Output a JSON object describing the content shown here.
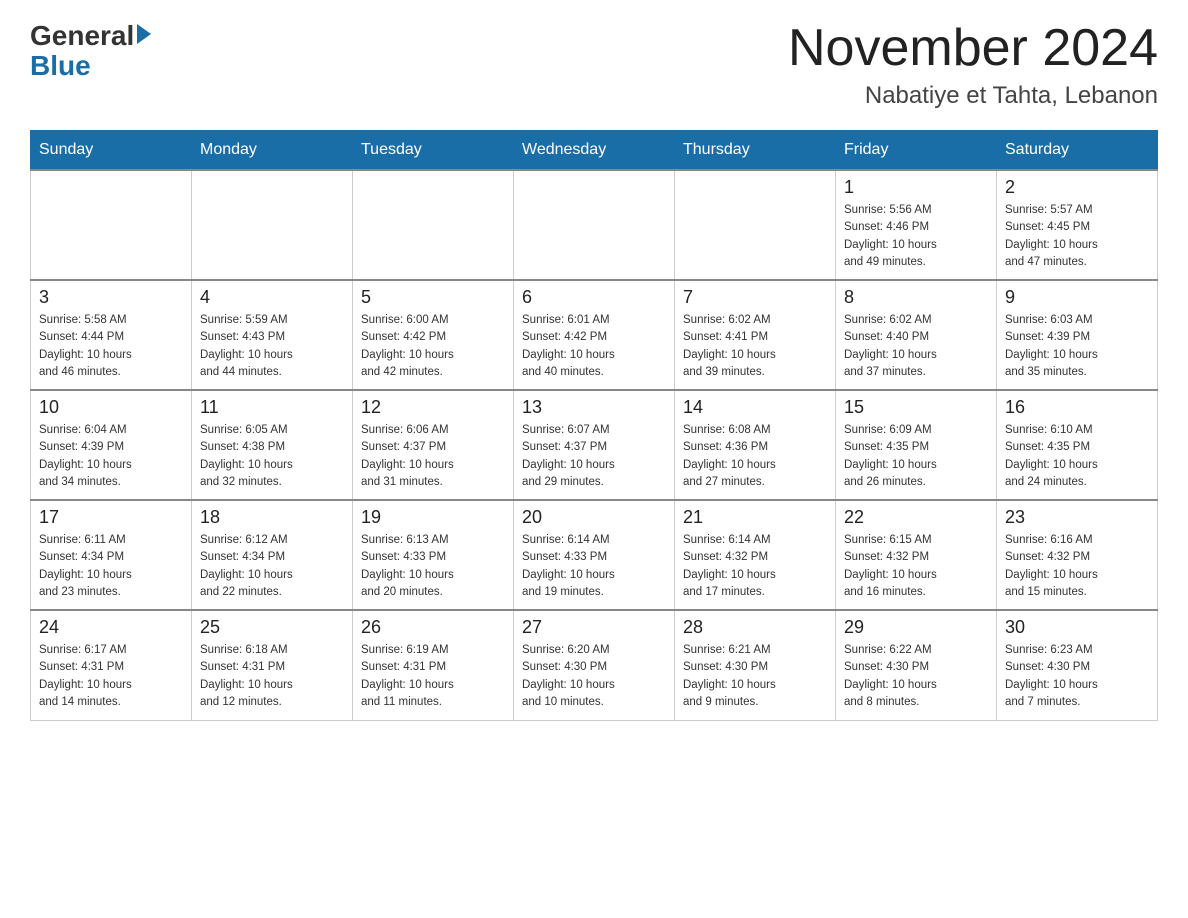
{
  "header": {
    "logo_general": "General",
    "logo_blue": "Blue",
    "title": "November 2024",
    "subtitle": "Nabatiye et Tahta, Lebanon"
  },
  "days_of_week": [
    "Sunday",
    "Monday",
    "Tuesday",
    "Wednesday",
    "Thursday",
    "Friday",
    "Saturday"
  ],
  "weeks": [
    [
      {
        "day": "",
        "info": ""
      },
      {
        "day": "",
        "info": ""
      },
      {
        "day": "",
        "info": ""
      },
      {
        "day": "",
        "info": ""
      },
      {
        "day": "",
        "info": ""
      },
      {
        "day": "1",
        "info": "Sunrise: 5:56 AM\nSunset: 4:46 PM\nDaylight: 10 hours\nand 49 minutes."
      },
      {
        "day": "2",
        "info": "Sunrise: 5:57 AM\nSunset: 4:45 PM\nDaylight: 10 hours\nand 47 minutes."
      }
    ],
    [
      {
        "day": "3",
        "info": "Sunrise: 5:58 AM\nSunset: 4:44 PM\nDaylight: 10 hours\nand 46 minutes."
      },
      {
        "day": "4",
        "info": "Sunrise: 5:59 AM\nSunset: 4:43 PM\nDaylight: 10 hours\nand 44 minutes."
      },
      {
        "day": "5",
        "info": "Sunrise: 6:00 AM\nSunset: 4:42 PM\nDaylight: 10 hours\nand 42 minutes."
      },
      {
        "day": "6",
        "info": "Sunrise: 6:01 AM\nSunset: 4:42 PM\nDaylight: 10 hours\nand 40 minutes."
      },
      {
        "day": "7",
        "info": "Sunrise: 6:02 AM\nSunset: 4:41 PM\nDaylight: 10 hours\nand 39 minutes."
      },
      {
        "day": "8",
        "info": "Sunrise: 6:02 AM\nSunset: 4:40 PM\nDaylight: 10 hours\nand 37 minutes."
      },
      {
        "day": "9",
        "info": "Sunrise: 6:03 AM\nSunset: 4:39 PM\nDaylight: 10 hours\nand 35 minutes."
      }
    ],
    [
      {
        "day": "10",
        "info": "Sunrise: 6:04 AM\nSunset: 4:39 PM\nDaylight: 10 hours\nand 34 minutes."
      },
      {
        "day": "11",
        "info": "Sunrise: 6:05 AM\nSunset: 4:38 PM\nDaylight: 10 hours\nand 32 minutes."
      },
      {
        "day": "12",
        "info": "Sunrise: 6:06 AM\nSunset: 4:37 PM\nDaylight: 10 hours\nand 31 minutes."
      },
      {
        "day": "13",
        "info": "Sunrise: 6:07 AM\nSunset: 4:37 PM\nDaylight: 10 hours\nand 29 minutes."
      },
      {
        "day": "14",
        "info": "Sunrise: 6:08 AM\nSunset: 4:36 PM\nDaylight: 10 hours\nand 27 minutes."
      },
      {
        "day": "15",
        "info": "Sunrise: 6:09 AM\nSunset: 4:35 PM\nDaylight: 10 hours\nand 26 minutes."
      },
      {
        "day": "16",
        "info": "Sunrise: 6:10 AM\nSunset: 4:35 PM\nDaylight: 10 hours\nand 24 minutes."
      }
    ],
    [
      {
        "day": "17",
        "info": "Sunrise: 6:11 AM\nSunset: 4:34 PM\nDaylight: 10 hours\nand 23 minutes."
      },
      {
        "day": "18",
        "info": "Sunrise: 6:12 AM\nSunset: 4:34 PM\nDaylight: 10 hours\nand 22 minutes."
      },
      {
        "day": "19",
        "info": "Sunrise: 6:13 AM\nSunset: 4:33 PM\nDaylight: 10 hours\nand 20 minutes."
      },
      {
        "day": "20",
        "info": "Sunrise: 6:14 AM\nSunset: 4:33 PM\nDaylight: 10 hours\nand 19 minutes."
      },
      {
        "day": "21",
        "info": "Sunrise: 6:14 AM\nSunset: 4:32 PM\nDaylight: 10 hours\nand 17 minutes."
      },
      {
        "day": "22",
        "info": "Sunrise: 6:15 AM\nSunset: 4:32 PM\nDaylight: 10 hours\nand 16 minutes."
      },
      {
        "day": "23",
        "info": "Sunrise: 6:16 AM\nSunset: 4:32 PM\nDaylight: 10 hours\nand 15 minutes."
      }
    ],
    [
      {
        "day": "24",
        "info": "Sunrise: 6:17 AM\nSunset: 4:31 PM\nDaylight: 10 hours\nand 14 minutes."
      },
      {
        "day": "25",
        "info": "Sunrise: 6:18 AM\nSunset: 4:31 PM\nDaylight: 10 hours\nand 12 minutes."
      },
      {
        "day": "26",
        "info": "Sunrise: 6:19 AM\nSunset: 4:31 PM\nDaylight: 10 hours\nand 11 minutes."
      },
      {
        "day": "27",
        "info": "Sunrise: 6:20 AM\nSunset: 4:30 PM\nDaylight: 10 hours\nand 10 minutes."
      },
      {
        "day": "28",
        "info": "Sunrise: 6:21 AM\nSunset: 4:30 PM\nDaylight: 10 hours\nand 9 minutes."
      },
      {
        "day": "29",
        "info": "Sunrise: 6:22 AM\nSunset: 4:30 PM\nDaylight: 10 hours\nand 8 minutes."
      },
      {
        "day": "30",
        "info": "Sunrise: 6:23 AM\nSunset: 4:30 PM\nDaylight: 10 hours\nand 7 minutes."
      }
    ]
  ]
}
